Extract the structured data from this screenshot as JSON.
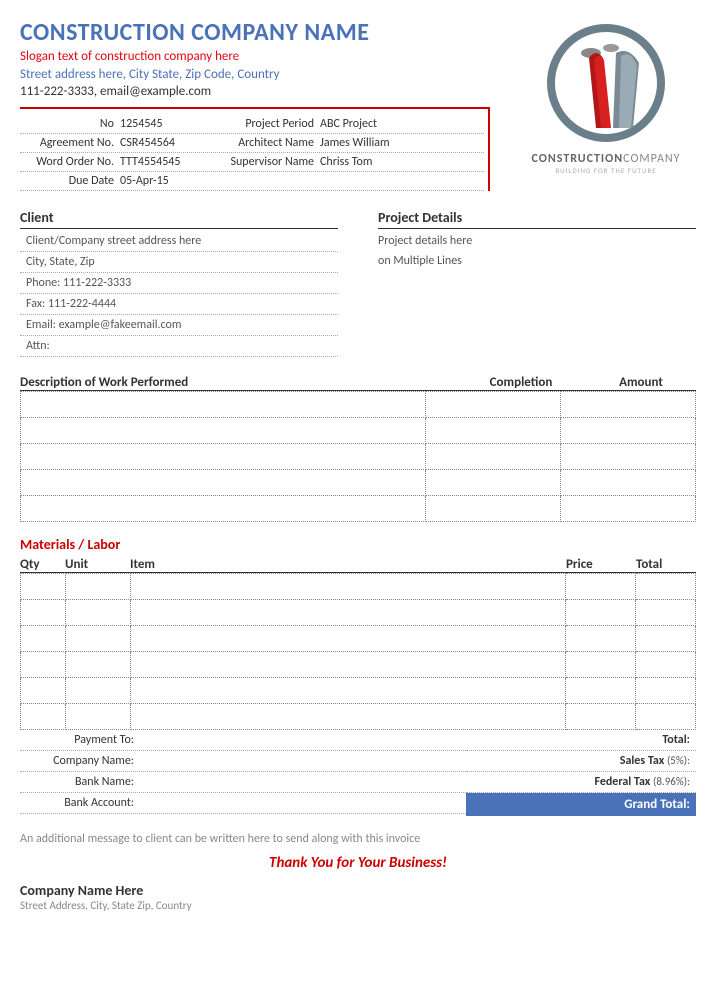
{
  "header": {
    "company_name": "CONSTRUCTION COMPANY NAME",
    "slogan": "Slogan text of construction company here",
    "address": "Street address here, City State, Zip Code, Country",
    "contact": "111-222-3333, email@example.com"
  },
  "logo": {
    "brand1": "CONSTRUCTION",
    "brand2": "COMPANY",
    "tagline": "BUILDING FOR THE FUTURE"
  },
  "info": {
    "no_label": "No",
    "no": "1254545",
    "period_label": "Project Period",
    "period": "ABC Project",
    "agreement_label": "Agreement No.",
    "agreement": "CSR454564",
    "architect_label": "Architect Name",
    "architect": "James William",
    "order_label": "Word Order No.",
    "order": "TTT4554545",
    "supervisor_label": "Supervisor Name",
    "supervisor": "Chriss Tom",
    "due_label": "Due Date",
    "due": "05-Apr-15"
  },
  "client": {
    "title": "Client",
    "lines": [
      "Client/Company street address here",
      "City, State, Zip",
      "Phone: 111-222-3333",
      "Fax: 111-222-4444",
      "Email: example@fakeemail.com",
      "Attn:"
    ]
  },
  "project": {
    "title": "Project Details",
    "line1": "Project details here",
    "line2": "on Multiple Lines"
  },
  "work": {
    "desc_h": "Description of Work Performed",
    "comp_h": "Completion",
    "amt_h": "Amount"
  },
  "materials": {
    "title": "Materials / Labor",
    "qty": "Qty",
    "unit": "Unit",
    "item": "Item",
    "price": "Price",
    "total": "Total"
  },
  "payment": {
    "to": "Payment To:",
    "company": "Company Name:",
    "bank": "Bank Name:",
    "account": "Bank Account:"
  },
  "totals": {
    "total": "Total:",
    "sales_tax": "Sales Tax",
    "sales_pct": "(5%):",
    "fed_tax": "Federal Tax",
    "fed_pct": "(8.96%):",
    "grand": "Grand Total:"
  },
  "footer": {
    "msg": "An additional message to client can be written here to send along with this invoice",
    "thanks": "Thank You for Your Business!",
    "company": "Company Name Here",
    "address": "Street Address, City, State Zip, Country"
  }
}
